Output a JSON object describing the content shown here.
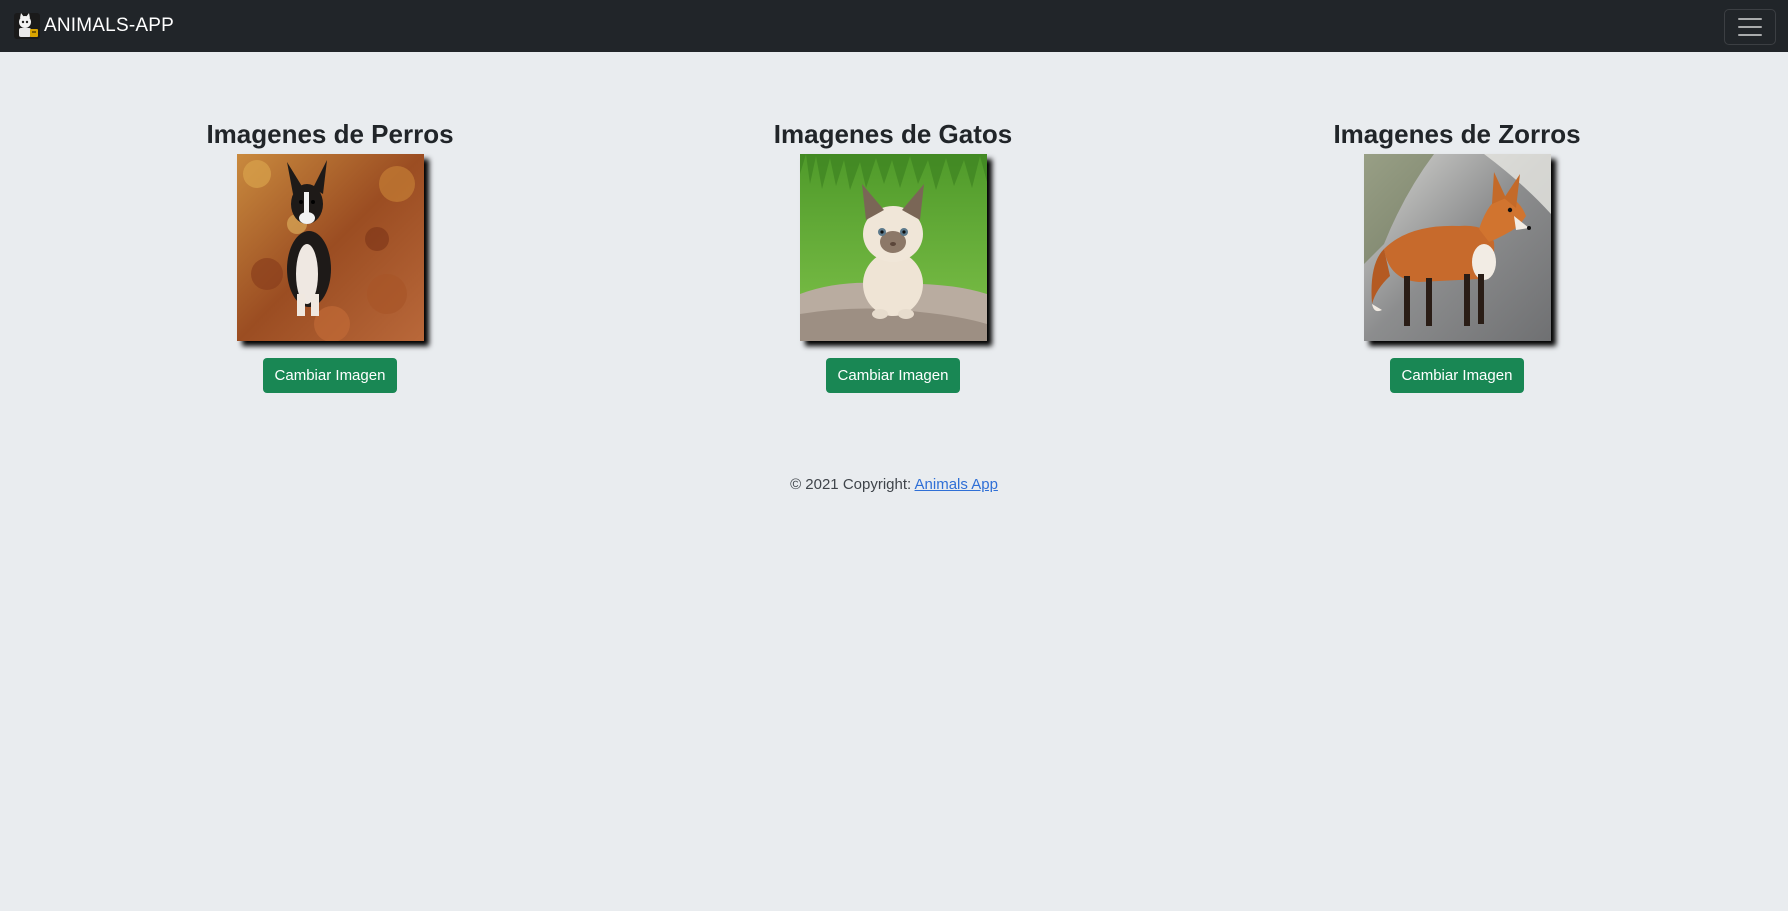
{
  "navbar": {
    "brand_text": "ANIMALS-APP",
    "logo_icon": "cat-logo-icon",
    "toggler_icon": "hamburger-menu-icon",
    "background": "#212529"
  },
  "sections": [
    {
      "title": "Imagenes de Perros",
      "image": "dog-in-autumn-leaves",
      "button_label": "Cambiar Imagen"
    },
    {
      "title": "Imagenes de Gatos",
      "image": "kitten-on-rock-with-grass",
      "button_label": "Cambiar Imagen"
    },
    {
      "title": "Imagenes de Zorros",
      "image": "red-fox-on-road",
      "button_label": "Cambiar Imagen"
    }
  ],
  "footer": {
    "copyright_text": "© 2021 Copyright: ",
    "link_text": "Animals App"
  },
  "colors": {
    "page_background": "#e9ecef",
    "button_green": "#198754",
    "link_blue": "#2f6fd6"
  }
}
